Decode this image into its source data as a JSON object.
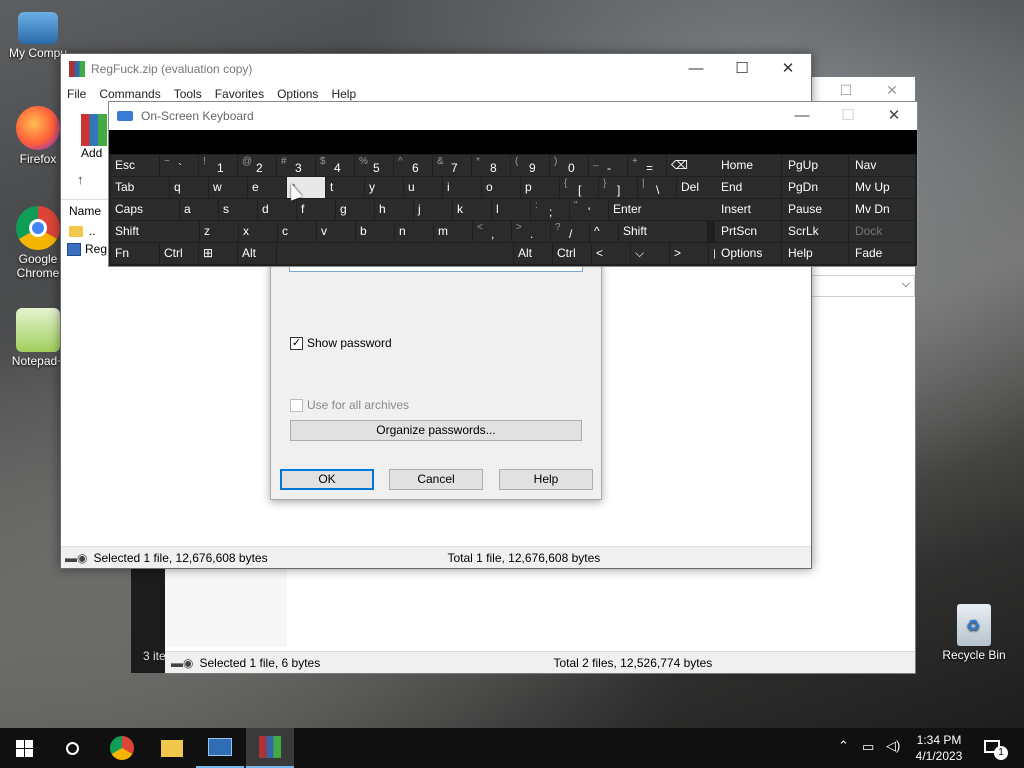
{
  "desktop": {
    "icons": [
      {
        "label": "My Compu"
      },
      {
        "label": "Firefox"
      },
      {
        "label": "Google Chrome"
      },
      {
        "label": "Notepad+"
      },
      {
        "label": "Recycle Bin"
      }
    ]
  },
  "back_window": {
    "status_left": "Selected 1 file, 6 bytes",
    "status_right": "Total 2 files, 12,526,774 bytes",
    "items_stub": "3 ite"
  },
  "front_window": {
    "title": "RegFuck.zip (evaluation copy)",
    "menu": [
      "File",
      "Commands",
      "Tools",
      "Favorites",
      "Options",
      "Help"
    ],
    "toolbar_add": "Add",
    "column_name": "Name",
    "rows": [
      "..",
      "RegF"
    ],
    "status_left": "Selected 1 file, 12,676,608 bytes",
    "status_right": "Total 1 file, 12,676,608 bytes"
  },
  "dialog": {
    "show_password": "Show password",
    "use_for_all": "Use for all archives",
    "organize": "Organize passwords...",
    "ok": "OK",
    "cancel": "Cancel",
    "help": "Help"
  },
  "osk": {
    "title": "On-Screen Keyboard",
    "rows": [
      [
        {
          "m": "Esc",
          "w": 48
        },
        {
          "s": "~",
          "m": "`",
          "w": 38
        },
        {
          "s": "!",
          "m": "1",
          "w": 38
        },
        {
          "s": "@",
          "m": "2",
          "w": 38
        },
        {
          "s": "#",
          "m": "3",
          "w": 38
        },
        {
          "s": "$",
          "m": "4",
          "w": 38
        },
        {
          "s": "%",
          "m": "5",
          "w": 38
        },
        {
          "s": "^",
          "m": "6",
          "w": 38
        },
        {
          "s": "&",
          "m": "7",
          "w": 38
        },
        {
          "s": "*",
          "m": "8",
          "w": 38
        },
        {
          "s": "(",
          "m": "9",
          "w": 38
        },
        {
          "s": ")",
          "m": "0",
          "w": 38
        },
        {
          "s": "_",
          "m": "-",
          "w": 38
        },
        {
          "s": "+",
          "m": "=",
          "w": 38
        },
        {
          "m": "⌫",
          "w": 64
        }
      ],
      [
        {
          "m": "Tab",
          "w": 58
        },
        {
          "m": "q",
          "w": 38
        },
        {
          "m": "w",
          "w": 38
        },
        {
          "m": "e",
          "w": 38
        },
        {
          "m": "r",
          "w": 38,
          "hl": true
        },
        {
          "m": "t",
          "w": 38
        },
        {
          "m": "y",
          "w": 38
        },
        {
          "m": "u",
          "w": 38
        },
        {
          "m": "i",
          "w": 38
        },
        {
          "m": "o",
          "w": 38
        },
        {
          "m": "p",
          "w": 38
        },
        {
          "s": "{",
          "m": "[",
          "w": 38
        },
        {
          "s": "}",
          "m": "]",
          "w": 38
        },
        {
          "s": "|",
          "m": "\\",
          "w": 38
        },
        {
          "m": "Del",
          "w": 46
        }
      ],
      [
        {
          "m": "Caps",
          "w": 68
        },
        {
          "m": "a",
          "w": 38
        },
        {
          "m": "s",
          "w": 38
        },
        {
          "m": "d",
          "w": 38
        },
        {
          "m": "f",
          "w": 38
        },
        {
          "m": "g",
          "w": 38
        },
        {
          "m": "h",
          "w": 38
        },
        {
          "m": "j",
          "w": 38
        },
        {
          "m": "k",
          "w": 38
        },
        {
          "m": "l",
          "w": 38
        },
        {
          "s": ":",
          "m": ";",
          "w": 38
        },
        {
          "s": "\"",
          "m": "'",
          "w": 38
        },
        {
          "m": "Enter",
          "w": 106
        }
      ],
      [
        {
          "m": "Shift",
          "w": 88
        },
        {
          "m": "z",
          "w": 38
        },
        {
          "m": "x",
          "w": 38
        },
        {
          "m": "c",
          "w": 38
        },
        {
          "m": "v",
          "w": 38
        },
        {
          "m": "b",
          "w": 38
        },
        {
          "m": "n",
          "w": 38
        },
        {
          "m": "m",
          "w": 38
        },
        {
          "s": "<",
          "m": ",",
          "w": 38
        },
        {
          "s": ">",
          "m": ".",
          "w": 38
        },
        {
          "s": "?",
          "m": "/",
          "w": 38
        },
        {
          "m": "^",
          "w": 28
        },
        {
          "m": "Shift",
          "w": 88
        }
      ],
      [
        {
          "m": "Fn",
          "w": 48
        },
        {
          "m": "Ctrl",
          "w": 38
        },
        {
          "m": "⊞",
          "w": 38
        },
        {
          "m": "Alt",
          "w": 38
        },
        {
          "m": "",
          "w": 236
        },
        {
          "m": "Alt",
          "w": 38
        },
        {
          "m": "Ctrl",
          "w": 38
        },
        {
          "m": "<",
          "w": 38
        },
        {
          "m": "⌵",
          "w": 38
        },
        {
          "m": ">",
          "w": 38
        },
        {
          "m": "▤",
          "w": 38
        }
      ]
    ],
    "nav": [
      [
        "Home",
        "PgUp",
        "Nav"
      ],
      [
        "End",
        "PgDn",
        "Mv Up"
      ],
      [
        "Insert",
        "Pause",
        "Mv Dn"
      ],
      [
        "PrtScn",
        "ScrLk",
        "Dock"
      ],
      [
        "Options",
        "Help",
        "Fade"
      ]
    ]
  },
  "tray": {
    "time": "1:34 PM",
    "date": "4/1/2023",
    "notifications": "1"
  }
}
